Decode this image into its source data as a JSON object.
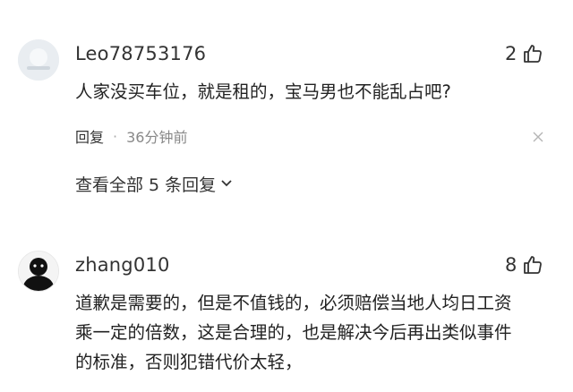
{
  "comments": [
    {
      "username": "Leo78753176",
      "likes": "2",
      "text": "人家没买车位，就是租的，宝马男也不能乱占吧?",
      "reply_label": "回复",
      "time": "36分钟前",
      "view_all": "查看全部 5 条回复"
    },
    {
      "username": "zhang010",
      "likes": "8",
      "text_lines": [
        "道歉是需要的，但是不值钱的，必须赔偿当地人均日工资",
        "乘一定的倍数，这是合理的，也是解决今后再出类似事件",
        "的标准，否则犯错代价太轻，"
      ]
    }
  ],
  "icons": {
    "like": "thumbs-up-icon",
    "close": "close-icon",
    "expand": "chevron-down-icon"
  },
  "colors": {
    "text": "#222222",
    "meta": "#888888",
    "icon": "#333333"
  }
}
